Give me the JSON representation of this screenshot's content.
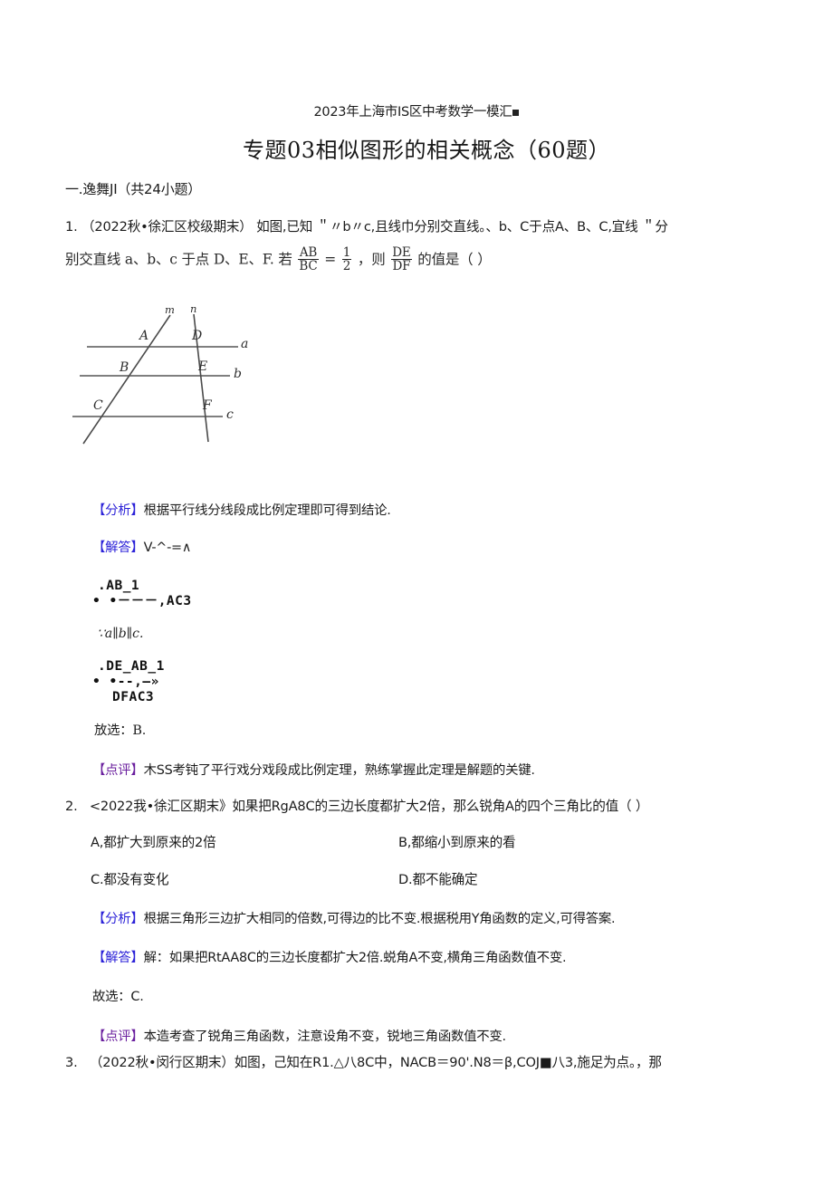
{
  "document": {
    "header": "2023年上海市IS区中考数学一模汇",
    "title": "专题03相似图形的相关概念（60题）",
    "section_heading": "一.逸舞JI（共24小题）"
  },
  "questions": [
    {
      "number": "1.",
      "source": "（2022秋•徐汇区校级期末）",
      "stem_line1": "如图,已知 ＂〃b〃c,且线巾分别交直线。、b、C于点A、B、C,宜线 ＂分",
      "stem_line2_pre": "别交直线 a、b、c 于点 D、E、F. 若",
      "frac1_num": "AB",
      "frac1_den": "BC",
      "equals": "=",
      "frac2_num": "1",
      "frac2_den": "2",
      "stem_line2_mid": "，则",
      "frac3_num": "DE",
      "frac3_den": "DF",
      "stem_line2_post": "的值是（    ）",
      "figure": {
        "transversal_m_label": "m",
        "transversal_n_label": "n",
        "line_a_label": "a",
        "line_b_label": "b",
        "line_c_label": "c",
        "point_A": "A",
        "point_B": "B",
        "point_C": "C",
        "point_D": "D",
        "point_E": "E",
        "point_F": "F"
      },
      "analysis_tag": "【分析】",
      "analysis_text": "根据平行线分线段成比例定理即可得到结论.",
      "answer_tag": "【解答】",
      "answer_text": "V-^-=∧",
      "frag_a_line1": ".AB_1",
      "frag_a_line2": "•  •－－－,AC3",
      "frag_parallel": "∵a∥b∥c.",
      "frag_b_line1": ".DE_AB_1",
      "frag_b_line2": "•   •--,—»",
      "frag_b_line3": "DFAC3",
      "choice_line": "放选：B.",
      "comment_tag": "【点评】",
      "comment_text": "木SS考钝了平行戏分戏段成比例定理，熟练掌握此定理是解题的关键."
    },
    {
      "number": "2.",
      "source": "<2022我•徐汇区期末》",
      "stem": "如果把RgA8C的三边长度都扩大2倍，那么锐角A的四个三角比的值（                    ）",
      "options": [
        "A,都扩大到原来的2倍",
        "B,都缩小到原来的看",
        "C.都没有变化",
        "D.都不能确定"
      ],
      "analysis_tag": "【分析】",
      "analysis_text": "根据三角形三边扩大相同的倍数,可得边的比不变.根据税用Y角函数的定义,可得答案.",
      "answer_tag": "【解答】",
      "answer_text": "解：如果把RtAA8C的三边长度都扩大2倍.蜕角A不变,横角三角函数值不变.",
      "choice_line": "故选：C.",
      "comment_tag": "【点评】",
      "comment_text": "本造考查了锐角三角函数，注意设角不变，锐地三角函数值不变."
    },
    {
      "number": "3.",
      "source": "（2022秋•闵行区期末）",
      "stem": "如图，己知在R1.△八8C中，NACB＝90'.N8＝β,COJ■八3,施足为点。，那"
    }
  ]
}
